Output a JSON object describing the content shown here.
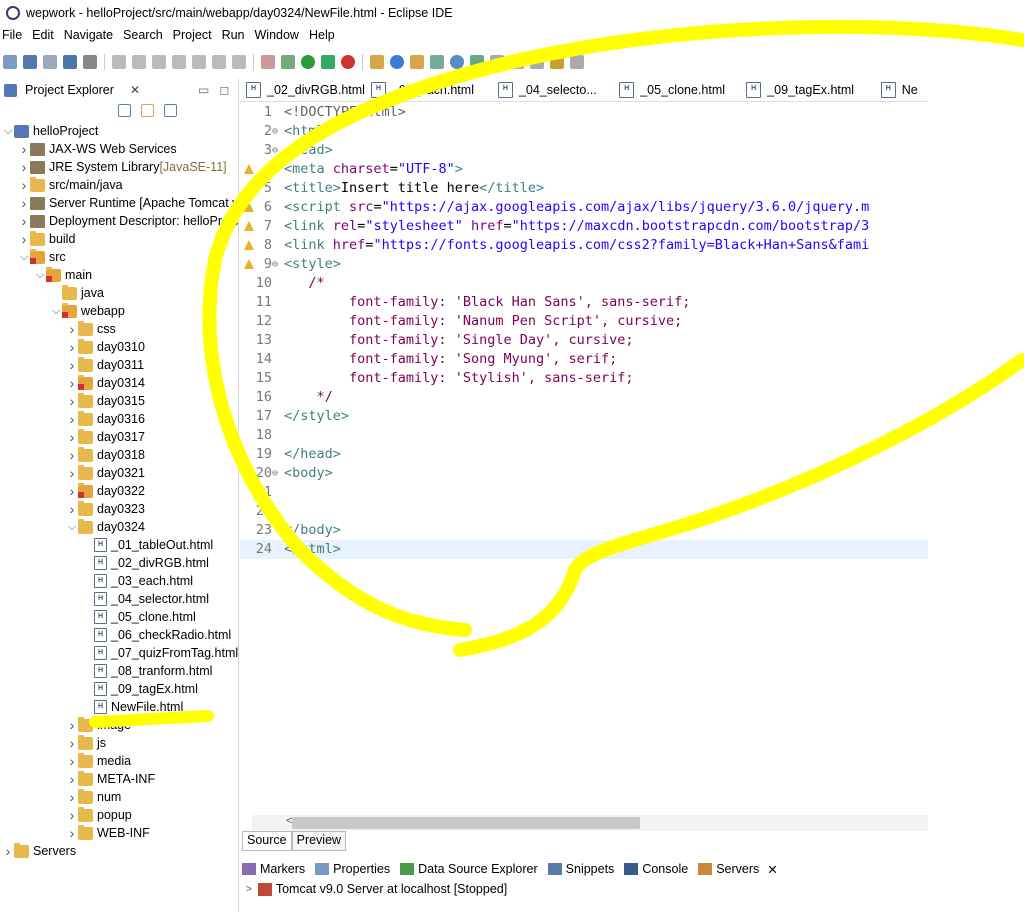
{
  "window": {
    "title": "wepwork - helloProject/src/main/webapp/day0324/NewFile.html - Eclipse IDE"
  },
  "menu": [
    "File",
    "Edit",
    "Navigate",
    "Search",
    "Project",
    "Run",
    "Window",
    "Help"
  ],
  "explorer": {
    "title": "Project Explorer",
    "tree": [
      {
        "label": "helloProject",
        "depth": 0,
        "chev": "v",
        "icon": "project"
      },
      {
        "label": "JAX-WS Web Services",
        "depth": 1,
        "chev": ">",
        "icon": "lib"
      },
      {
        "label": "JRE System Library",
        "suffix": "[JavaSE-11]",
        "depth": 1,
        "chev": ">",
        "icon": "lib"
      },
      {
        "label": "src/main/java",
        "depth": 1,
        "chev": ">",
        "icon": "folder"
      },
      {
        "label": "Server Runtime [Apache Tomcat v",
        "depth": 1,
        "chev": ">",
        "icon": "lib"
      },
      {
        "label": "Deployment Descriptor: helloProje",
        "depth": 1,
        "chev": ">",
        "icon": "lib"
      },
      {
        "label": "build",
        "depth": 1,
        "chev": ">",
        "icon": "folder"
      },
      {
        "label": "src",
        "depth": 1,
        "chev": "v",
        "icon": "folder-red"
      },
      {
        "label": "main",
        "depth": 2,
        "chev": "v",
        "icon": "folder-red"
      },
      {
        "label": "java",
        "depth": 3,
        "chev": "",
        "icon": "folder"
      },
      {
        "label": "webapp",
        "depth": 3,
        "chev": "v",
        "icon": "folder-red"
      },
      {
        "label": "css",
        "depth": 4,
        "chev": ">",
        "icon": "folder"
      },
      {
        "label": "day0310",
        "depth": 4,
        "chev": ">",
        "icon": "folder"
      },
      {
        "label": "day0311",
        "depth": 4,
        "chev": ">",
        "icon": "folder"
      },
      {
        "label": "day0314",
        "depth": 4,
        "chev": ">",
        "icon": "folder-red"
      },
      {
        "label": "day0315",
        "depth": 4,
        "chev": ">",
        "icon": "folder"
      },
      {
        "label": "day0316",
        "depth": 4,
        "chev": ">",
        "icon": "folder"
      },
      {
        "label": "day0317",
        "depth": 4,
        "chev": ">",
        "icon": "folder"
      },
      {
        "label": "day0318",
        "depth": 4,
        "chev": ">",
        "icon": "folder"
      },
      {
        "label": "day0321",
        "depth": 4,
        "chev": ">",
        "icon": "folder"
      },
      {
        "label": "day0322",
        "depth": 4,
        "chev": ">",
        "icon": "folder-red"
      },
      {
        "label": "day0323",
        "depth": 4,
        "chev": ">",
        "icon": "folder"
      },
      {
        "label": "day0324",
        "depth": 4,
        "chev": "v",
        "icon": "folder"
      },
      {
        "label": "_01_tableOut.html",
        "depth": 5,
        "chev": "",
        "icon": "file"
      },
      {
        "label": "_02_divRGB.html",
        "depth": 5,
        "chev": "",
        "icon": "file"
      },
      {
        "label": "_03_each.html",
        "depth": 5,
        "chev": "",
        "icon": "file"
      },
      {
        "label": "_04_selector.html",
        "depth": 5,
        "chev": "",
        "icon": "file"
      },
      {
        "label": "_05_clone.html",
        "depth": 5,
        "chev": "",
        "icon": "file"
      },
      {
        "label": "_06_checkRadio.html",
        "depth": 5,
        "chev": "",
        "icon": "file"
      },
      {
        "label": "_07_quizFromTag.html",
        "depth": 5,
        "chev": "",
        "icon": "file"
      },
      {
        "label": "_08_tranform.html",
        "depth": 5,
        "chev": "",
        "icon": "file"
      },
      {
        "label": "_09_tagEx.html",
        "depth": 5,
        "chev": "",
        "icon": "file"
      },
      {
        "label": "NewFile.html",
        "depth": 5,
        "chev": "",
        "icon": "file"
      },
      {
        "label": "image",
        "depth": 4,
        "chev": ">",
        "icon": "folder"
      },
      {
        "label": "js",
        "depth": 4,
        "chev": ">",
        "icon": "folder"
      },
      {
        "label": "media",
        "depth": 4,
        "chev": ">",
        "icon": "folder"
      },
      {
        "label": "META-INF",
        "depth": 4,
        "chev": ">",
        "icon": "folder"
      },
      {
        "label": "num",
        "depth": 4,
        "chev": ">",
        "icon": "folder"
      },
      {
        "label": "popup",
        "depth": 4,
        "chev": ">",
        "icon": "folder"
      },
      {
        "label": "WEB-INF",
        "depth": 4,
        "chev": ">",
        "icon": "folder"
      },
      {
        "label": "Servers",
        "depth": 0,
        "chev": ">",
        "icon": "folder"
      }
    ]
  },
  "editor_tabs": [
    "_02_divRGB.html",
    "_03_each.html",
    "_04_selecto...",
    "_05_clone.html",
    "_09_tagEx.html",
    "Ne"
  ],
  "code": [
    {
      "n": "1",
      "fold": "",
      "warn": false,
      "html": "<span class='doc'>&lt;!DOCTYPE html&gt;</span>"
    },
    {
      "n": "2",
      "fold": "⊖",
      "warn": false,
      "html": "<span class='tag'>&lt;html&gt;</span>"
    },
    {
      "n": "3",
      "fold": "⊖",
      "warn": false,
      "html": "<span class='tag'>&lt;head&gt;</span>"
    },
    {
      "n": "4",
      "fold": "",
      "warn": true,
      "html": "<span class='tag'>&lt;meta</span> <span class='attr'>charset</span>=<span class='str'>\"UTF-8\"</span><span class='tag'>&gt;</span>"
    },
    {
      "n": "5",
      "fold": "",
      "warn": false,
      "html": "<span class='tag'>&lt;title&gt;</span>Insert title here<span class='tag'>&lt;/title&gt;</span>"
    },
    {
      "n": "6",
      "fold": "",
      "warn": true,
      "html": "<span class='tag'>&lt;script</span> <span class='attr'>src</span>=<span class='str'>\"https://ajax.googleapis.com/ajax/libs/jquery/3.6.0/jquery.m</span>"
    },
    {
      "n": "7",
      "fold": "",
      "warn": true,
      "html": "<span class='tag'>&lt;link</span> <span class='attr'>rel</span>=<span class='str'>\"stylesheet\"</span> <span class='attr'>href</span>=<span class='str'>\"https://maxcdn.bootstrapcdn.com/bootstrap/3</span>"
    },
    {
      "n": "8",
      "fold": "",
      "warn": true,
      "html": "<span class='tag'>&lt;link</span> <span class='attr'>href</span>=<span class='str'>\"https://fonts.googleapis.com/css2?family=Black+Han+Sans&amp;fami</span>"
    },
    {
      "n": "9",
      "fold": "⊖",
      "warn": true,
      "html": "<span class='tag'>&lt;style&gt;</span>"
    },
    {
      "n": "10",
      "fold": "",
      "warn": false,
      "html": "   <span class='cmtx'>/*</span>"
    },
    {
      "n": "11",
      "fold": "",
      "warn": false,
      "html": "        <span class='cmtx'>font-family: 'Black Han Sans', sans-serif;</span>"
    },
    {
      "n": "12",
      "fold": "",
      "warn": false,
      "html": "        <span class='cmtx'>font-family: 'Nanum Pen Script', cursive;</span>"
    },
    {
      "n": "13",
      "fold": "",
      "warn": false,
      "html": "        <span class='cmtx'>font-family: 'Single Day', cursive;</span>"
    },
    {
      "n": "14",
      "fold": "",
      "warn": false,
      "html": "        <span class='cmtx'>font-family: 'Song Myung', serif;</span>"
    },
    {
      "n": "15",
      "fold": "",
      "warn": false,
      "html": "        <span class='cmtx'>font-family: 'Stylish', sans-serif;</span>"
    },
    {
      "n": "16",
      "fold": "",
      "warn": false,
      "html": "    <span class='cmtx'>*/</span>"
    },
    {
      "n": "17",
      "fold": "",
      "warn": false,
      "html": "<span class='tag'>&lt;/style&gt;</span>"
    },
    {
      "n": "18",
      "fold": "",
      "warn": false,
      "html": ""
    },
    {
      "n": "19",
      "fold": "",
      "warn": false,
      "html": "<span class='tag'>&lt;/head&gt;</span>"
    },
    {
      "n": "20",
      "fold": "⊖",
      "warn": false,
      "html": "<span class='tag'>&lt;body&gt;</span>"
    },
    {
      "n": "21",
      "fold": "",
      "warn": false,
      "html": ""
    },
    {
      "n": "22",
      "fold": "",
      "warn": false,
      "html": ""
    },
    {
      "n": "23",
      "fold": "",
      "warn": false,
      "html": "<span class='tag'>&lt;/body&gt;</span>"
    },
    {
      "n": "24",
      "fold": "",
      "warn": false,
      "html": "<span class='tag'>&lt;/html&gt;</span>",
      "current": true
    }
  ],
  "editor_subtabs": [
    "Source",
    "Preview"
  ],
  "bottom_tabs": [
    "Markers",
    "Properties",
    "Data Source Explorer",
    "Snippets",
    "Console",
    "Servers"
  ],
  "server_row": "Tomcat v9.0 Server at localhost  [Stopped]",
  "colors": {
    "annotation": "#ffff00"
  }
}
